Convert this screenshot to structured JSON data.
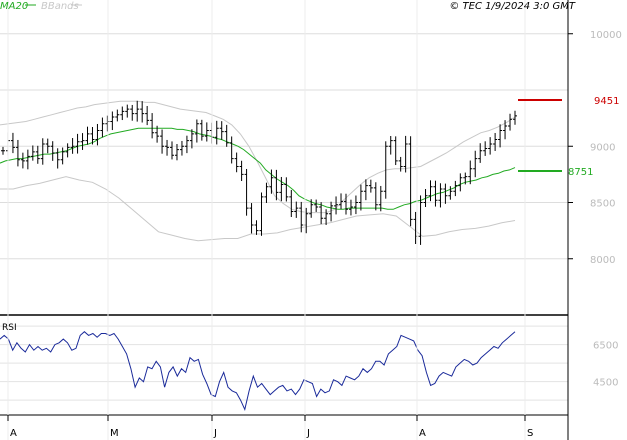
{
  "header": {
    "ma_label": "MA20",
    "bb_label": "BBands",
    "source": "© TEC 1/9/2024 3:0 GMT"
  },
  "colors": {
    "ma": "#22aa22",
    "bbands": "#c8c8c8",
    "price": "#000000",
    "rsi": "#1a2a9a",
    "resistance": "#cc0000",
    "support": "#22aa22"
  },
  "chart_data": [
    {
      "type": "ohlc",
      "ylim": [
        7500,
        10300
      ],
      "y_ticks": [
        8000,
        8500,
        9000,
        10000
      ],
      "y_tick_labels": [
        "8000",
        "8500",
        "9000",
        "10000"
      ],
      "x_tick_labels": [
        "A",
        "M",
        "J",
        "J",
        "A",
        "S"
      ],
      "grid": true,
      "series": [
        {
          "name": "MA20"
        },
        {
          "name": "BBands"
        }
      ],
      "close": [
        8960,
        9050,
        8990,
        8880,
        8870,
        8910,
        8950,
        8890,
        9020,
        9000,
        8940,
        8880,
        8950,
        8990,
        9000,
        9040,
        9050,
        9110,
        9060,
        9140,
        9200,
        9220,
        9260,
        9280,
        9310,
        9330,
        9290,
        9330,
        9290,
        9230,
        9120,
        9090,
        9000,
        8990,
        8920,
        8970,
        9000,
        9050,
        9110,
        9200,
        9090,
        9140,
        9080,
        9160,
        9130,
        9030,
        8890,
        8820,
        8750,
        8450,
        8300,
        8250,
        8550,
        8640,
        8720,
        8590,
        8660,
        8550,
        8420,
        8450,
        8300,
        8400,
        8480,
        8460,
        8360,
        8400,
        8470,
        8480,
        8510,
        8440,
        8460,
        8500,
        8600,
        8650,
        8630,
        8480,
        8600,
        9000,
        9050,
        8870,
        8820,
        9020,
        8350,
        8200,
        8500,
        8560,
        8640,
        8520,
        8620,
        8560,
        8600,
        8650,
        8720,
        8730,
        8800,
        8890,
        8960,
        8980,
        9020,
        9060,
        9140,
        9180,
        9240,
        9270
      ],
      "ma20": [
        8850,
        8870,
        8880,
        8890,
        8890,
        8900,
        8910,
        8920,
        8930,
        8930,
        8940,
        8950,
        8960,
        8980,
        9000,
        9010,
        9020,
        9040,
        9070,
        9090,
        9110,
        9120,
        9130,
        9140,
        9150,
        9160,
        9160,
        9160,
        9160,
        9160,
        9160,
        9160,
        9150,
        9150,
        9140,
        9130,
        9110,
        9100,
        9090,
        9070,
        9060,
        9040,
        9020,
        9000,
        8970,
        8930,
        8890,
        8850,
        8790,
        8750,
        8710,
        8680,
        8650,
        8610,
        8560,
        8530,
        8510,
        8490,
        8480,
        8460,
        8450,
        8440,
        8440,
        8450,
        8450,
        8450,
        8450,
        8450,
        8450,
        8450,
        8440,
        8440,
        8460,
        8480,
        8490,
        8510,
        8520,
        8540,
        8560,
        8580,
        8590,
        8610,
        8630,
        8660,
        8680,
        8690,
        8700,
        8720,
        8730,
        8750,
        8760,
        8780,
        8790,
        8810
      ],
      "bb_upper": [
        9190,
        9200,
        9210,
        9220,
        9240,
        9260,
        9280,
        9300,
        9320,
        9340,
        9350,
        9370,
        9380,
        9390,
        9400,
        9400,
        9400,
        9390,
        9390,
        9370,
        9350,
        9330,
        9320,
        9310,
        9300,
        9270,
        9240,
        9190,
        9110,
        9000,
        8860,
        8710,
        8560,
        8490,
        8440,
        8420,
        8410,
        8410,
        8410,
        8440,
        8520,
        8590,
        8660,
        8720,
        8760,
        8790,
        8800,
        8800,
        8810,
        8820,
        8860,
        8900,
        8940,
        8990,
        9040,
        9080,
        9120,
        9140,
        9170,
        9210,
        9260
      ],
      "bb_lower": [
        8620,
        8620,
        8650,
        8670,
        8700,
        8730,
        8700,
        8680,
        8620,
        8540,
        8440,
        8340,
        8240,
        8210,
        8180,
        8160,
        8170,
        8180,
        8180,
        8220,
        8220,
        8230,
        8260,
        8280,
        8300,
        8320,
        8350,
        8380,
        8390,
        8400,
        8380,
        8290,
        8200,
        8210,
        8240,
        8260,
        8270,
        8290,
        8320,
        8340
      ]
    },
    {
      "type": "line",
      "ylabel": "RSI",
      "ylim": [
        27,
        81
      ],
      "y_ticks": [
        45,
        65
      ],
      "y_tick_labels": [
        "4500",
        "6500"
      ],
      "values": [
        68,
        70,
        68,
        62,
        66,
        63,
        61,
        65,
        62,
        64,
        62,
        63,
        61,
        65,
        66,
        68,
        66,
        62,
        63,
        70,
        72,
        70,
        71,
        69,
        71,
        71,
        70,
        71,
        68,
        64,
        60,
        52,
        42,
        47,
        45,
        53,
        52,
        56,
        53,
        42,
        50,
        53,
        48,
        52,
        50,
        58,
        56,
        57,
        49,
        44,
        38,
        37,
        45,
        50,
        42,
        40,
        39,
        35,
        30,
        40,
        48,
        42,
        44,
        41,
        38,
        40,
        42,
        43,
        40,
        41,
        38,
        41,
        46,
        45,
        44,
        37,
        41,
        39,
        40,
        46,
        45,
        43,
        48,
        47,
        46,
        48,
        52,
        50,
        52,
        56,
        56,
        54,
        60,
        62,
        64,
        70,
        69,
        68,
        67,
        62,
        59,
        50,
        43,
        44,
        48,
        50,
        49,
        48,
        53,
        55,
        57,
        56,
        54,
        55,
        58,
        60,
        62,
        64,
        63,
        66,
        68,
        70,
        72
      ]
    }
  ],
  "annotations": {
    "resistance": {
      "value": 9451,
      "label": "9451"
    },
    "support": {
      "value": 8751,
      "label": "8751"
    }
  },
  "rsi_panel": {
    "label": "RSI"
  }
}
